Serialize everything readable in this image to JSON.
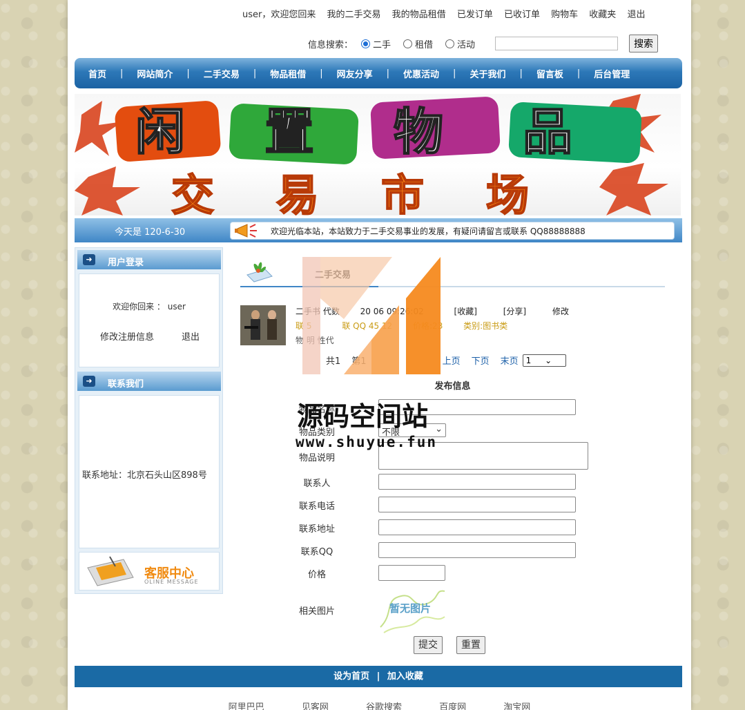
{
  "toplinks": {
    "welcome": "user，欢迎您回来",
    "items": [
      "我的二手交易",
      "我的物品租借",
      "已发订单",
      "已收订单",
      "购物车",
      "收藏夹",
      "退出"
    ]
  },
  "search": {
    "label": "信息搜索：",
    "options": [
      "二手",
      "租借",
      "活动"
    ],
    "selected": "二手",
    "value": "",
    "button": "搜索"
  },
  "nav": [
    "首页",
    "网站简介",
    "二手交易",
    "物品租借",
    "网友分享",
    "优惠活动",
    "关于我们",
    "留言板",
    "后台管理"
  ],
  "nav_sep": "|",
  "banner": {
    "line1": "闲置物品",
    "line2": "交易市场"
  },
  "datebar": {
    "date": "今天是 120-6-30",
    "notice": "欢迎光临本站，本站致力于二手交易事业的发展，有疑问请留言或联系 QQ88888888"
  },
  "sidebar": {
    "login_title": "用户登录",
    "welcome": "欢迎你回来 ： user",
    "edit_profile": "修改注册信息",
    "logout": "退出",
    "contact_title": "联系我们",
    "address": "联系地址：北京石头山区898号",
    "service_title": "客服中心",
    "service_sub": "OLINE MESSAGE"
  },
  "main": {
    "section_title": "二手交易",
    "item": {
      "title": "二手书 代数",
      "time": "20 06 09:26:02",
      "fav": "[收藏]",
      "share": "[分享]",
      "edit": "修改",
      "contact": "联",
      "contact_value": "5",
      "qq": "联 QQ 45 12",
      "price": "价格:23",
      "category": "类别:图书类",
      "desc": "物 明 性代"
    },
    "pager": {
      "total": "共1",
      "page": "第1",
      "prev": "上页",
      "next": "下页",
      "last": "末页",
      "select": "1"
    },
    "form": {
      "title": "发布信息",
      "name_label": "物品名称",
      "category_label": "物品类别",
      "category_value": "不限",
      "desc_label": "物品说明",
      "contact_label": "联系人",
      "phone_label": "联系电话",
      "address_label": "联系地址",
      "qq_label": "联系QQ",
      "price_label": "价格",
      "image_label": "相关图片",
      "image_placeholder": "暂无图片",
      "submit": "提交",
      "reset": "重置"
    }
  },
  "footer": {
    "set_home": "设为首页",
    "sep": "|",
    "bookmark": "加入收藏"
  },
  "links": [
    "阿里巴巴",
    "见客网",
    "谷歌搜索",
    "百度网",
    "淘宝网"
  ],
  "watermark": {
    "text": "源码空间站",
    "url": "www.shuyue.fun"
  },
  "colors": {
    "nav": "#2d78b8",
    "footer": "#1a6aa5",
    "accent_text": "#c99b14",
    "link": "#1b5fa8"
  }
}
